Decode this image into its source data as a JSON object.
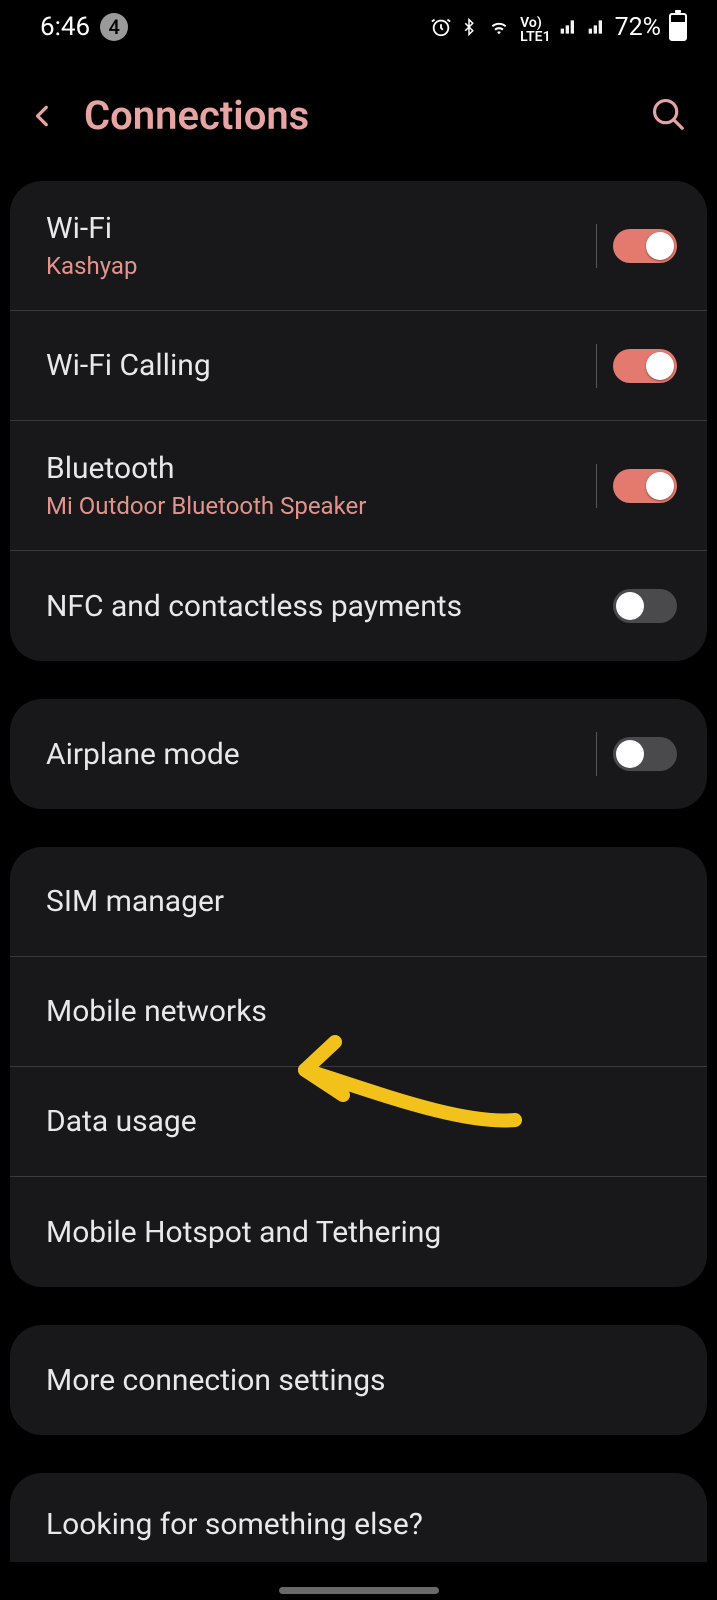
{
  "status_bar": {
    "time": "6:46",
    "notif_count": "4",
    "battery_pct": "72%"
  },
  "header": {
    "title": "Connections"
  },
  "group1": {
    "wifi": {
      "title": "Wi-Fi",
      "subtitle": "Kashyap",
      "toggle": "on"
    },
    "wifi_calling": {
      "title": "Wi-Fi Calling",
      "toggle": "on"
    },
    "bluetooth": {
      "title": "Bluetooth",
      "subtitle": "Mi Outdoor Bluetooth Speaker",
      "toggle": "on"
    },
    "nfc": {
      "title": "NFC and contactless payments",
      "toggle": "off"
    }
  },
  "group2": {
    "airplane": {
      "title": "Airplane mode",
      "toggle": "off"
    }
  },
  "group3": {
    "sim": {
      "title": "SIM manager"
    },
    "mobile_networks": {
      "title": "Mobile networks"
    },
    "data_usage": {
      "title": "Data usage"
    },
    "hotspot": {
      "title": "Mobile Hotspot and Tethering"
    }
  },
  "group4": {
    "more": {
      "title": "More connection settings"
    }
  },
  "footer": {
    "title": "Looking for something else?"
  }
}
